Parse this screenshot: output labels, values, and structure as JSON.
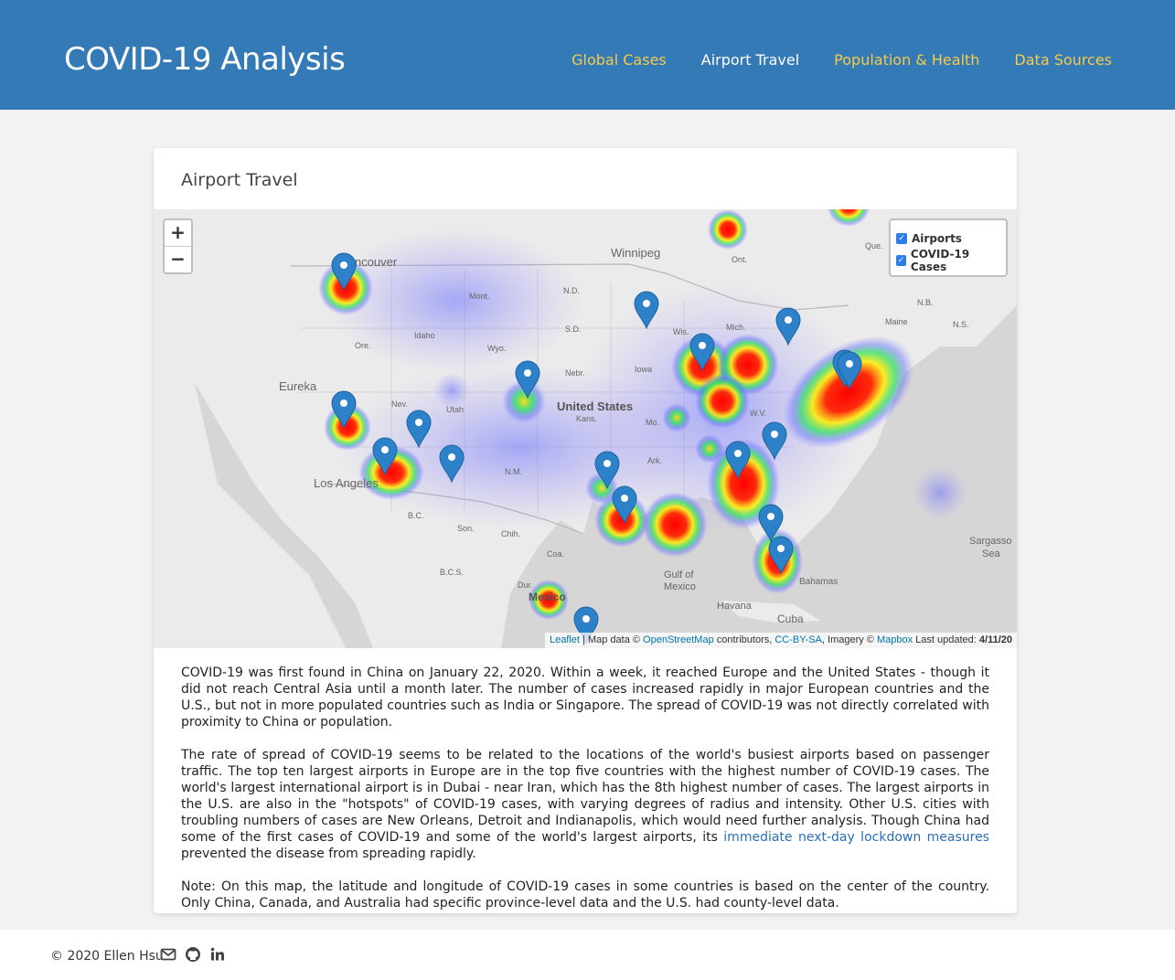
{
  "header": {
    "brand": "COVID-19 Analysis",
    "nav": [
      {
        "label": "Global Cases"
      },
      {
        "label": "Airport Travel"
      },
      {
        "label": "Population & Health"
      },
      {
        "label": "Data Sources"
      }
    ],
    "active_nav": "Airport Travel"
  },
  "colors": {
    "header_bg": "#347ab7",
    "nav_link": "#f4cb4a",
    "nav_active": "#ffffff",
    "marker": "#2c81c8",
    "link": "#2a6fb6"
  },
  "card": {
    "title": "Airport Travel"
  },
  "map": {
    "zoom_in": "+",
    "zoom_out": "−",
    "layers": [
      {
        "label": "Airports",
        "checked": true
      },
      {
        "label": "COVID-19 Cases",
        "checked": true
      }
    ],
    "labels": {
      "winnipeg": "Winnipeg",
      "vancouver": "Vancouver",
      "eureka": "Eureka",
      "los_angeles": "Los Angeles",
      "united_states": "United States",
      "gulf": "Gulf of",
      "mexico_sea": "Mexico",
      "havana": "Havana",
      "cuba": "Cuba",
      "bahamas": "Bahamas",
      "sargasso": "Sargasso",
      "sea": "Sea",
      "mont": "Mont.",
      "nd": "N.D.",
      "sd": "S.D.",
      "idaho": "Idaho",
      "wyo": "Wyo.",
      "ore": "Ore.",
      "nebr": "Nebr.",
      "iowa": "Iowa",
      "kans": "Kans.",
      "nev": "Nev.",
      "utah": "Utah",
      "nm": "N.M.",
      "ark": "Ark.",
      "mo": "Mo.",
      "wis": "Wis.",
      "mich": "Mich.",
      "ont": "Ont.",
      "que": "Que.",
      "maine": "Maine",
      "nb": "N.B.",
      "ns": "N.S.",
      "wv": "W.V.",
      "bc": "B.C.",
      "son": "Son.",
      "chih": "Chih.",
      "coa": "Coa.",
      "bcs": "B.C.S.",
      "dur": "Dur.",
      "mexico_country": "Mexico"
    },
    "attribution": {
      "leaflet": "Leaflet",
      "sep1": " | Map data © ",
      "osm": "OpenStreetMap",
      "sep2": " contributors, ",
      "ccbysa": "CC-BY-SA",
      "sep3": ", Imagery © ",
      "mapbox": "Mapbox",
      "updated_label": " Last updated: ",
      "updated_value": "4/11/20"
    }
  },
  "body": {
    "p1": "COVID-19 was first found in China on January 22, 2020. Within a week, it reached Europe and the United States - though it did not reach Central Asia until a month later. The number of cases increased rapidly in major European countries and the U.S., but not in more populated countries such as India or Singapore. The spread of COVID-19 was not directly correlated with proximity to China or population.",
    "p2_before": "The rate of spread of COVID-19 seems to be related to the locations of the world's busiest airports based on passenger traffic. The top ten largest airports in Europe are in the top five countries with the highest number of COVID-19 cases. The world's largest international airport is in Dubai - near Iran, which has the 8th highest number of cases. The largest airports in the U.S. are also in the \"hotspots\" of COVID-19 cases, with varying degrees of radius and intensity. Other U.S. cities with troubling numbers of cases are New Orleans, Detroit and Indianapolis, which would need further analysis. Though China had some of the first cases of COVID-19 and some of the world's largest airports, its ",
    "p2_link": "immediate next-day lockdown measures",
    "p2_after": " prevented the disease from spreading rapidly.",
    "p3": "Note: On this map, the latitude and longitude of COVID-19 cases in some countries is based on the center of the country. Only China, Canada, and Australia had specific province-level data and the U.S. had county-level data."
  },
  "footer": {
    "copyright": "© 2020 Ellen Hsu",
    "icons": [
      "envelope-icon",
      "github-icon",
      "linkedin-icon"
    ]
  }
}
